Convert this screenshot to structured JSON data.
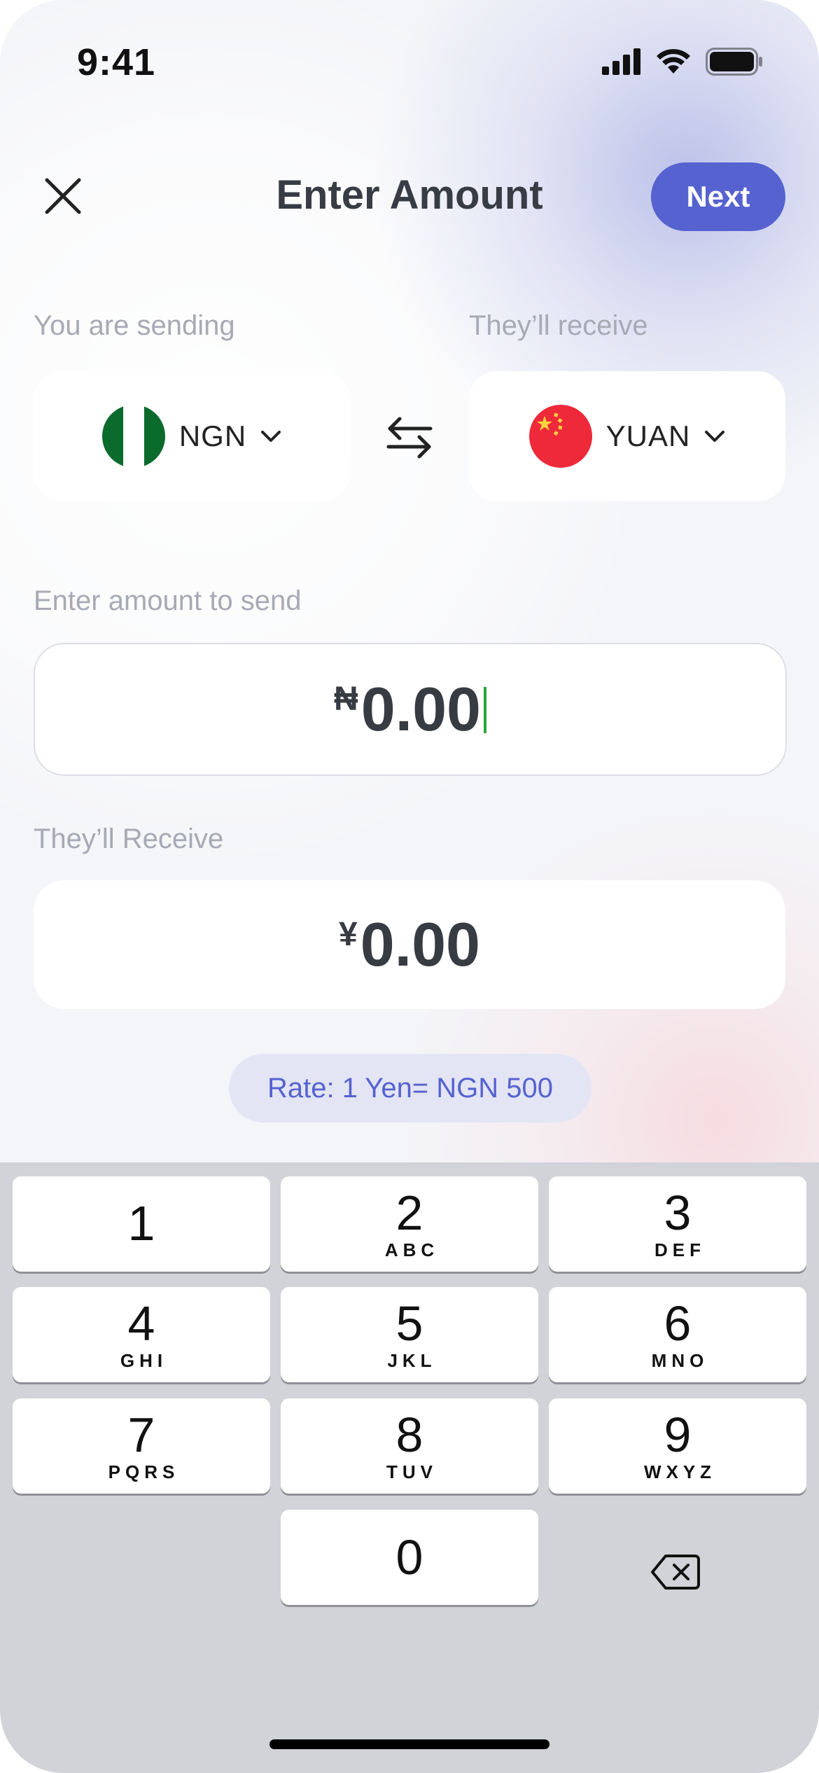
{
  "status_bar": {
    "time": "9:41",
    "icons": [
      "cellular-signal-icon",
      "wifi-icon",
      "battery-icon"
    ]
  },
  "header": {
    "title": "Enter Amount",
    "close_icon": "close-icon",
    "next_label": "Next"
  },
  "sending": {
    "label": "You are sending",
    "currency_code": "NGN",
    "flag_icon": "nigeria-flag-icon",
    "dropdown_icon": "chevron-down-icon"
  },
  "receiving": {
    "label": "They’ll receive",
    "currency_code": "YUAN",
    "flag_icon": "china-flag-icon",
    "dropdown_icon": "chevron-down-icon"
  },
  "swap_icon": "swap-arrows-icon",
  "send_amount": {
    "label": "Enter amount to send",
    "symbol": "₦",
    "value": "0.00"
  },
  "receive_amount": {
    "label": "They’ll Receive",
    "symbol": "¥",
    "value": "0.00"
  },
  "rate": {
    "text": "Rate: 1 Yen= NGN 500"
  },
  "keypad": {
    "keys": [
      {
        "num": "1",
        "letters": ""
      },
      {
        "num": "2",
        "letters": "ABC"
      },
      {
        "num": "3",
        "letters": "DEF"
      },
      {
        "num": "4",
        "letters": "GHI"
      },
      {
        "num": "5",
        "letters": "JKL"
      },
      {
        "num": "6",
        "letters": "MNO"
      },
      {
        "num": "7",
        "letters": "PQRS"
      },
      {
        "num": "8",
        "letters": "TUV"
      },
      {
        "num": "9",
        "letters": "WXYZ"
      },
      {
        "num": "0",
        "letters": ""
      }
    ],
    "backspace_icon": "backspace-icon"
  },
  "colors": {
    "accent": "#5662d0",
    "rate_pill_bg": "#e3e5f5",
    "caret": "#2aa43a",
    "keyboard_bg": "#d1d3d9"
  }
}
